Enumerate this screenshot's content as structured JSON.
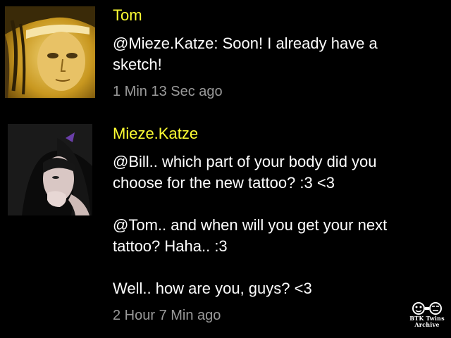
{
  "posts": [
    {
      "username": "Tom",
      "message_lines": [
        "@Mieze.Katze: Soon! I already have a",
        "sketch!"
      ],
      "timestamp": "1 Min 13 Sec ago",
      "avatar": "user-avatar-tom"
    },
    {
      "username": "Mieze.Katze",
      "message_paragraphs": [
        [
          "@Bill.. which part of your body did you",
          "choose for the new tattoo? :3 <3"
        ],
        [
          "@Tom.. and when will you get your next",
          "tattoo? Haha.. :3"
        ],
        [
          "Well.. how are you, guys? <3"
        ]
      ],
      "timestamp": "2 Hour 7 Min ago",
      "avatar": "user-avatar-mieze-katze"
    }
  ],
  "watermark": {
    "line1": "BTK Twins",
    "line2": "Archive"
  },
  "colors": {
    "background": "#000000",
    "username": "#ffff33",
    "message": "#ffffff",
    "timestamp": "#9a9a9a"
  }
}
